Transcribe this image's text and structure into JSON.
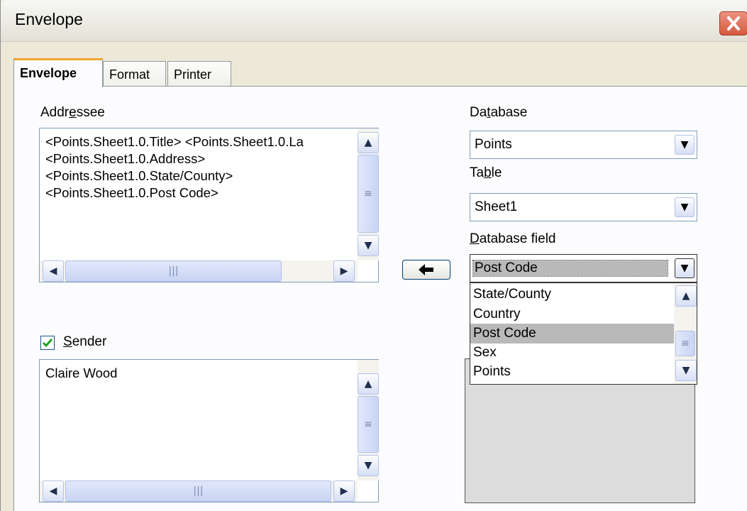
{
  "window": {
    "title": "Envelope"
  },
  "tabs": [
    {
      "label": "Envelope"
    },
    {
      "label": "Format"
    },
    {
      "label": "Printer"
    }
  ],
  "addressee": {
    "label_pre": "Addr",
    "label_u": "e",
    "label_post": "ssee",
    "text": "<Points.Sheet1.0.Title> <Points.Sheet1.0.La\n<Points.Sheet1.0.Address>\n<Points.Sheet1.0.State/County>\n<Points.Sheet1.0.Post Code>"
  },
  "sender": {
    "checked": true,
    "label_u": "S",
    "label_post": "ender",
    "text": "Claire Wood"
  },
  "database": {
    "label_pre": "Da",
    "label_u": "t",
    "label_post": "abase",
    "value": "Points"
  },
  "table": {
    "label_pre": "Ta",
    "label_u": "b",
    "label_post": "le",
    "value": "Sheet1"
  },
  "database_field": {
    "label_u": "D",
    "label_post": "atabase field",
    "value": "Post Code",
    "options": [
      "State/County",
      "Country",
      "Post Code",
      "Sex",
      "Points"
    ],
    "highlighted": "Post Code"
  },
  "insert_arrow_icon": "arrow-left-icon",
  "colors": {
    "highlight": "#b9b9b9",
    "tab_accent": "#f1a32d",
    "close": "#d45a3e"
  }
}
